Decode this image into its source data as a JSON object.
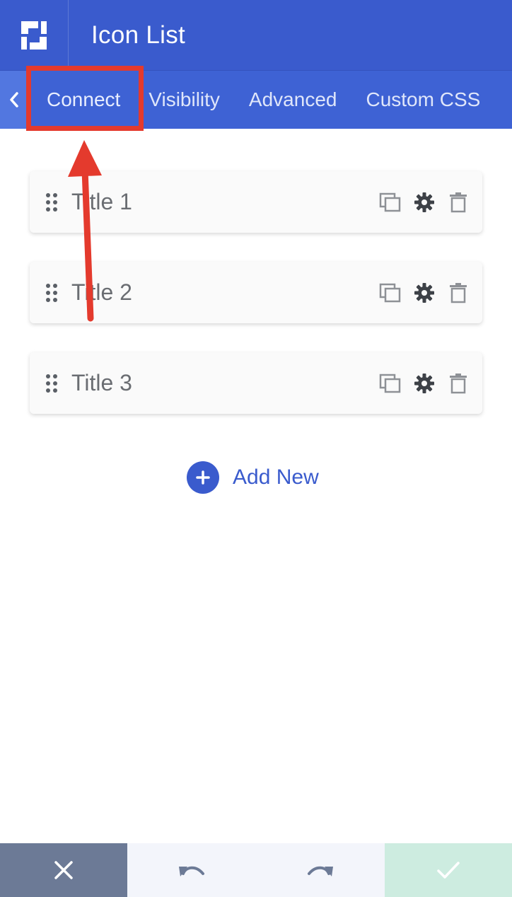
{
  "header": {
    "title": "Icon List",
    "logo_icon": "builder-logo-icon",
    "background": "#3a5bcd"
  },
  "tabs": {
    "back_icon": "chevron-left-icon",
    "items": [
      {
        "label": "Connect",
        "active": true
      },
      {
        "label": "Visibility"
      },
      {
        "label": "Advanced"
      },
      {
        "label": "Custom CSS"
      }
    ],
    "background": "#3e62d4"
  },
  "annotation": {
    "highlight_color": "#e43a2d",
    "arrow_color": "#e43a2d"
  },
  "list": {
    "items": [
      {
        "title": "Title 1"
      },
      {
        "title": "Title 2"
      },
      {
        "title": "Title 3"
      }
    ],
    "action_icons": [
      "duplicate-icon",
      "gear-icon",
      "trash-icon"
    ]
  },
  "add_new": {
    "label": "Add New",
    "icon": "plus-circle-icon",
    "color": "#3a5bcd"
  },
  "footer": {
    "cancel_icon": "close-icon",
    "undo_icon": "undo-icon",
    "redo_icon": "redo-icon",
    "save_icon": "check-icon",
    "cancel_color": "#6c7a96",
    "save_color": "#cdece0"
  }
}
